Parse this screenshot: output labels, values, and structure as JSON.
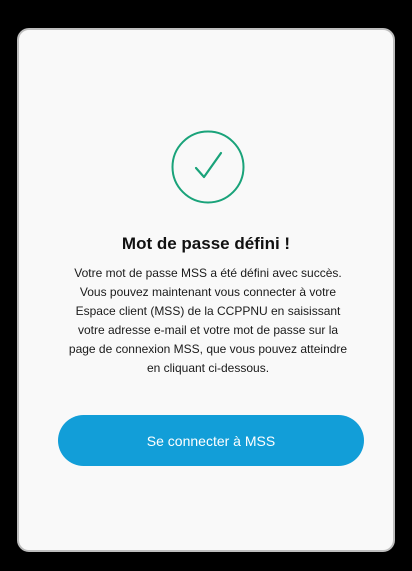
{
  "success": {
    "icon": "check-circle-icon",
    "icon_color": "#1aa37a",
    "title": "Mot de passe défini !",
    "message_lines": [
      "Votre mot de passe MSS a été défini avec succès.",
      "Vous pouvez maintenant vous connecter à votre",
      "Espace client (MSS) de la CCPPNU en saisissant",
      "votre adresse e-mail et votre mot de passe sur la",
      "page de connexion MSS, que vous pouvez atteindre",
      "en cliquant ci-dessous."
    ],
    "button_label": "Se connecter à MSS",
    "button_color": "#129ed8"
  }
}
